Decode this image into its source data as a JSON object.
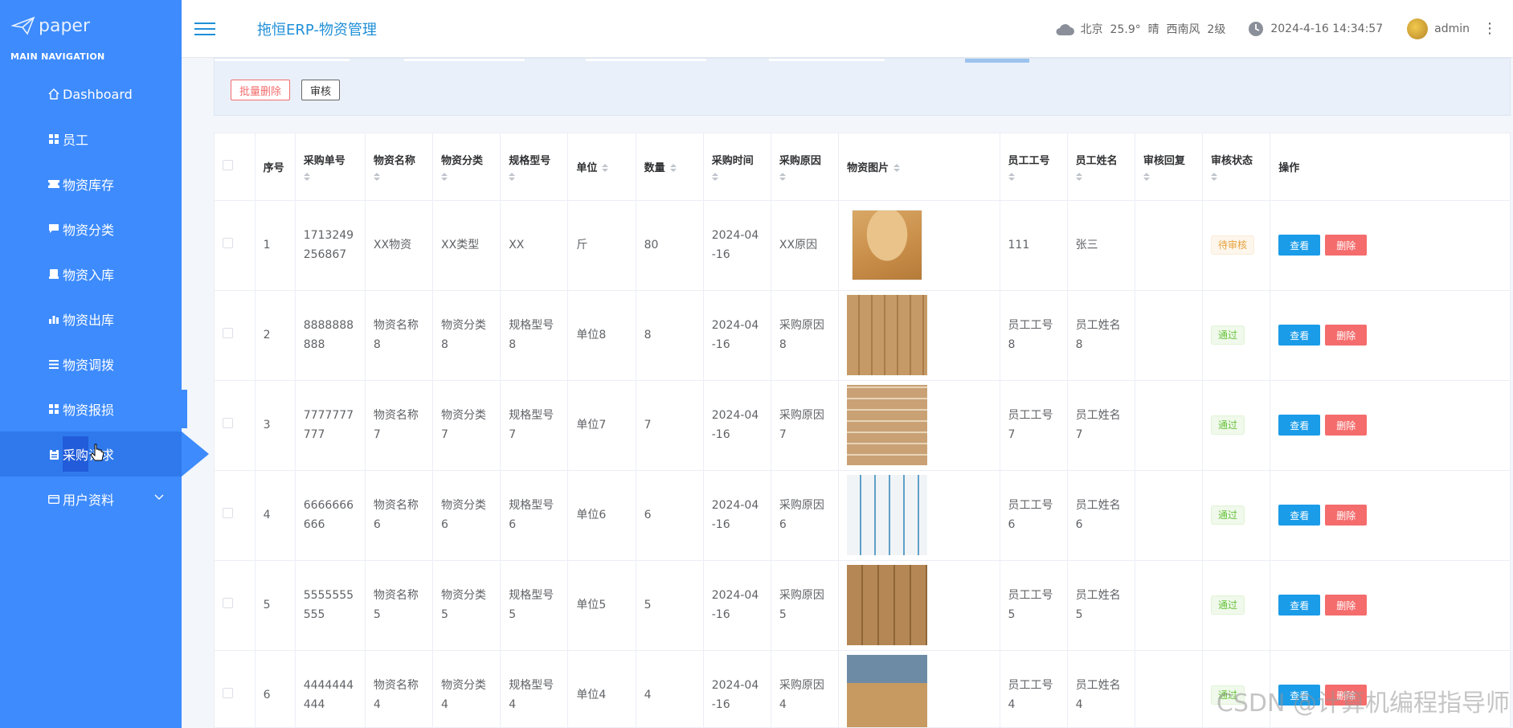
{
  "sidebar": {
    "logo": "paper",
    "heading": "MAIN NAVIGATION",
    "items": [
      {
        "label": "Dashboard",
        "icon": "home-icon"
      },
      {
        "label": "员工",
        "icon": "grid-icon"
      },
      {
        "label": "物资库存",
        "icon": "ticket-icon"
      },
      {
        "label": "物资分类",
        "icon": "comment-icon"
      },
      {
        "label": "物资入库",
        "icon": "inbox-icon"
      },
      {
        "label": "物资出库",
        "icon": "bar-chart-icon"
      },
      {
        "label": "物资调拨",
        "icon": "list-icon"
      },
      {
        "label": "物资报损",
        "icon": "grid-icon"
      },
      {
        "label": "采购请求",
        "icon": "clipboard-icon"
      },
      {
        "label": "用户资料",
        "icon": "card-icon"
      }
    ]
  },
  "header": {
    "title": "拖恒ERP-物资管理",
    "weather": "北京  25.9°  晴  西南风  2级",
    "datetime": "2024-4-16 14:34:57",
    "user": "admin"
  },
  "toolbar": {
    "batch_delete": "批量删除",
    "audit": "审核"
  },
  "table": {
    "headers": {
      "index": "序号",
      "order_no": "采购单号",
      "name": "物资名称",
      "category": "物资分类",
      "spec": "规格型号",
      "unit": "单位",
      "qty": "数量",
      "time": "采购时间",
      "reason": "采购原因",
      "image": "物资图片",
      "emp_no": "员工工号",
      "emp_name": "员工姓名",
      "reply": "审核回复",
      "status": "审核状态",
      "ops": "操作"
    },
    "view_label": "查看",
    "delete_label": "删除",
    "rows": [
      {
        "index": "1",
        "order_no": "1713249256867",
        "name": "XX物资",
        "category": "XX类型",
        "spec": "XX",
        "unit": "斤",
        "qty": "80",
        "time": "2024-04-16",
        "reason": "XX原因",
        "emp_no": "111",
        "emp_name": "张三",
        "reply": "",
        "status": "待审核",
        "status_type": "pending"
      },
      {
        "index": "2",
        "order_no": "8888888888",
        "name": "物资名称8",
        "category": "物资分类8",
        "spec": "规格型号8",
        "unit": "单位8",
        "qty": "8",
        "time": "2024-04-16",
        "reason": "采购原因8",
        "emp_no": "员工工号8",
        "emp_name": "员工姓名8",
        "reply": "",
        "status": "通过",
        "status_type": "pass"
      },
      {
        "index": "3",
        "order_no": "7777777777",
        "name": "物资名称7",
        "category": "物资分类7",
        "spec": "规格型号7",
        "unit": "单位7",
        "qty": "7",
        "time": "2024-04-16",
        "reason": "采购原因7",
        "emp_no": "员工工号7",
        "emp_name": "员工姓名7",
        "reply": "",
        "status": "通过",
        "status_type": "pass"
      },
      {
        "index": "4",
        "order_no": "6666666666",
        "name": "物资名称6",
        "category": "物资分类6",
        "spec": "规格型号6",
        "unit": "单位6",
        "qty": "6",
        "time": "2024-04-16",
        "reason": "采购原因6",
        "emp_no": "员工工号6",
        "emp_name": "员工姓名6",
        "reply": "",
        "status": "通过",
        "status_type": "pass"
      },
      {
        "index": "5",
        "order_no": "5555555555",
        "name": "物资名称5",
        "category": "物资分类5",
        "spec": "规格型号5",
        "unit": "单位5",
        "qty": "5",
        "time": "2024-04-16",
        "reason": "采购原因5",
        "emp_no": "员工工号5",
        "emp_name": "员工姓名5",
        "reply": "",
        "status": "通过",
        "status_type": "pass"
      },
      {
        "index": "6",
        "order_no": "4444444444",
        "name": "物资名称4",
        "category": "物资分类4",
        "spec": "规格型号4",
        "unit": "单位4",
        "qty": "4",
        "time": "2024-04-16",
        "reason": "采购原因4",
        "emp_no": "员工工号4",
        "emp_name": "员工姓名4",
        "reply": "",
        "status": "通过",
        "status_type": "pass"
      }
    ]
  },
  "watermark": "CSDN @计算机编程指导师",
  "colors": {
    "sidebar": "#3d8bfd",
    "accent": "#1f8fd8",
    "danger": "#f56c6c",
    "view": "#1a9ce8"
  }
}
